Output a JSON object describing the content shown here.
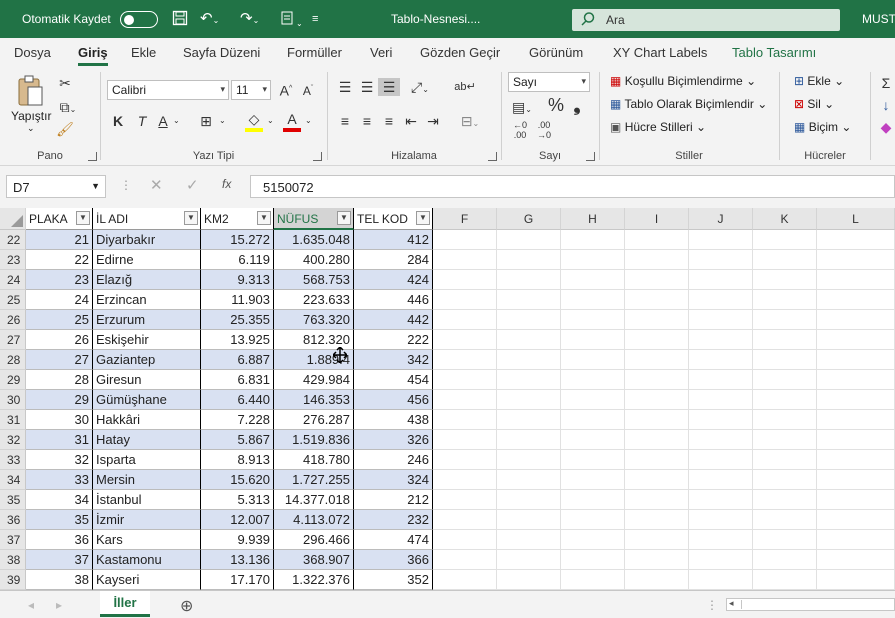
{
  "titlebar": {
    "autosave_label": "Otomatik Kaydet",
    "doc_title": "Tablo-Nesnesi....",
    "search_placeholder": "Ara",
    "user": "MUST"
  },
  "tabs": [
    "Dosya",
    "Giriş",
    "Ekle",
    "Sayfa Düzeni",
    "Formüller",
    "Veri",
    "Gözden Geçir",
    "Görünüm",
    "XY Chart Labels",
    "Tablo Tasarımı"
  ],
  "active_tab": "Giriş",
  "ribbon": {
    "clipboard": {
      "paste": "Yapıştır",
      "label": "Pano"
    },
    "font": {
      "name": "Calibri",
      "size": "11",
      "label": "Yazı Tipi",
      "bold": "K",
      "italic": "T",
      "underline": "A"
    },
    "alignment": {
      "label": "Hizalama"
    },
    "number": {
      "format": "Sayı",
      "label": "Sayı",
      "percent": "%"
    },
    "styles": {
      "conditional": "Koşullu Biçimlendirme",
      "as_table": "Tablo Olarak Biçimlendir",
      "cell_styles": "Hücre Stilleri",
      "label": "Stiller"
    },
    "cells": {
      "insert": "Ekle",
      "delete": "Sil",
      "format": "Biçim",
      "label": "Hücreler"
    }
  },
  "formula_bar": {
    "name_box": "D7",
    "formula": "5150072"
  },
  "columns": [
    "PLAKA",
    "İL ADI",
    "KM2",
    "NÜFUS",
    "TEL KOD",
    "F",
    "G",
    "H",
    "I",
    "J",
    "K",
    "L"
  ],
  "rows": [
    {
      "r": "22",
      "plaka": "21",
      "il": "Diyarbakır",
      "km2": "15.272",
      "nufus": "1.635.048",
      "tel": "412"
    },
    {
      "r": "23",
      "plaka": "22",
      "il": "Edirne",
      "km2": "6.119",
      "nufus": "400.280",
      "tel": "284"
    },
    {
      "r": "24",
      "plaka": "23",
      "il": "Elazığ",
      "km2": "9.313",
      "nufus": "568.753",
      "tel": "424"
    },
    {
      "r": "25",
      "plaka": "24",
      "il": "Erzincan",
      "km2": "11.903",
      "nufus": "223.633",
      "tel": "446"
    },
    {
      "r": "26",
      "plaka": "25",
      "il": "Erzurum",
      "km2": "25.355",
      "nufus": "763.320",
      "tel": "442"
    },
    {
      "r": "27",
      "plaka": "26",
      "il": "Eskişehir",
      "km2": "13.925",
      "nufus": "812.320",
      "tel": "222"
    },
    {
      "r": "28",
      "plaka": "27",
      "il": "Gaziantep",
      "km2": "6.887",
      "nufus": "1.889.4",
      "tel": "342"
    },
    {
      "r": "29",
      "plaka": "28",
      "il": "Giresun",
      "km2": "6.831",
      "nufus": "429.984",
      "tel": "454"
    },
    {
      "r": "30",
      "plaka": "29",
      "il": "Gümüşhane",
      "km2": "6.440",
      "nufus": "146.353",
      "tel": "456"
    },
    {
      "r": "31",
      "plaka": "30",
      "il": "Hakkâri",
      "km2": "7.228",
      "nufus": "276.287",
      "tel": "438"
    },
    {
      "r": "32",
      "plaka": "31",
      "il": "Hatay",
      "km2": "5.867",
      "nufus": "1.519.836",
      "tel": "326"
    },
    {
      "r": "33",
      "plaka": "32",
      "il": "Isparta",
      "km2": "8.913",
      "nufus": "418.780",
      "tel": "246"
    },
    {
      "r": "34",
      "plaka": "33",
      "il": "Mersin",
      "km2": "15.620",
      "nufus": "1.727.255",
      "tel": "324"
    },
    {
      "r": "35",
      "plaka": "34",
      "il": "İstanbul",
      "km2": "5.313",
      "nufus": "14.377.018",
      "tel": "212"
    },
    {
      "r": "36",
      "plaka": "35",
      "il": "İzmir",
      "km2": "12.007",
      "nufus": "4.113.072",
      "tel": "232"
    },
    {
      "r": "37",
      "plaka": "36",
      "il": "Kars",
      "km2": "9.939",
      "nufus": "296.466",
      "tel": "474"
    },
    {
      "r": "38",
      "plaka": "37",
      "il": "Kastamonu",
      "km2": "13.136",
      "nufus": "368.907",
      "tel": "366"
    },
    {
      "r": "39",
      "plaka": "38",
      "il": "Kayseri",
      "km2": "17.170",
      "nufus": "1.322.376",
      "tel": "352"
    }
  ],
  "sheet_tab": "İller",
  "colors": {
    "excel_green": "#217346",
    "band": "#d9e1f2"
  }
}
